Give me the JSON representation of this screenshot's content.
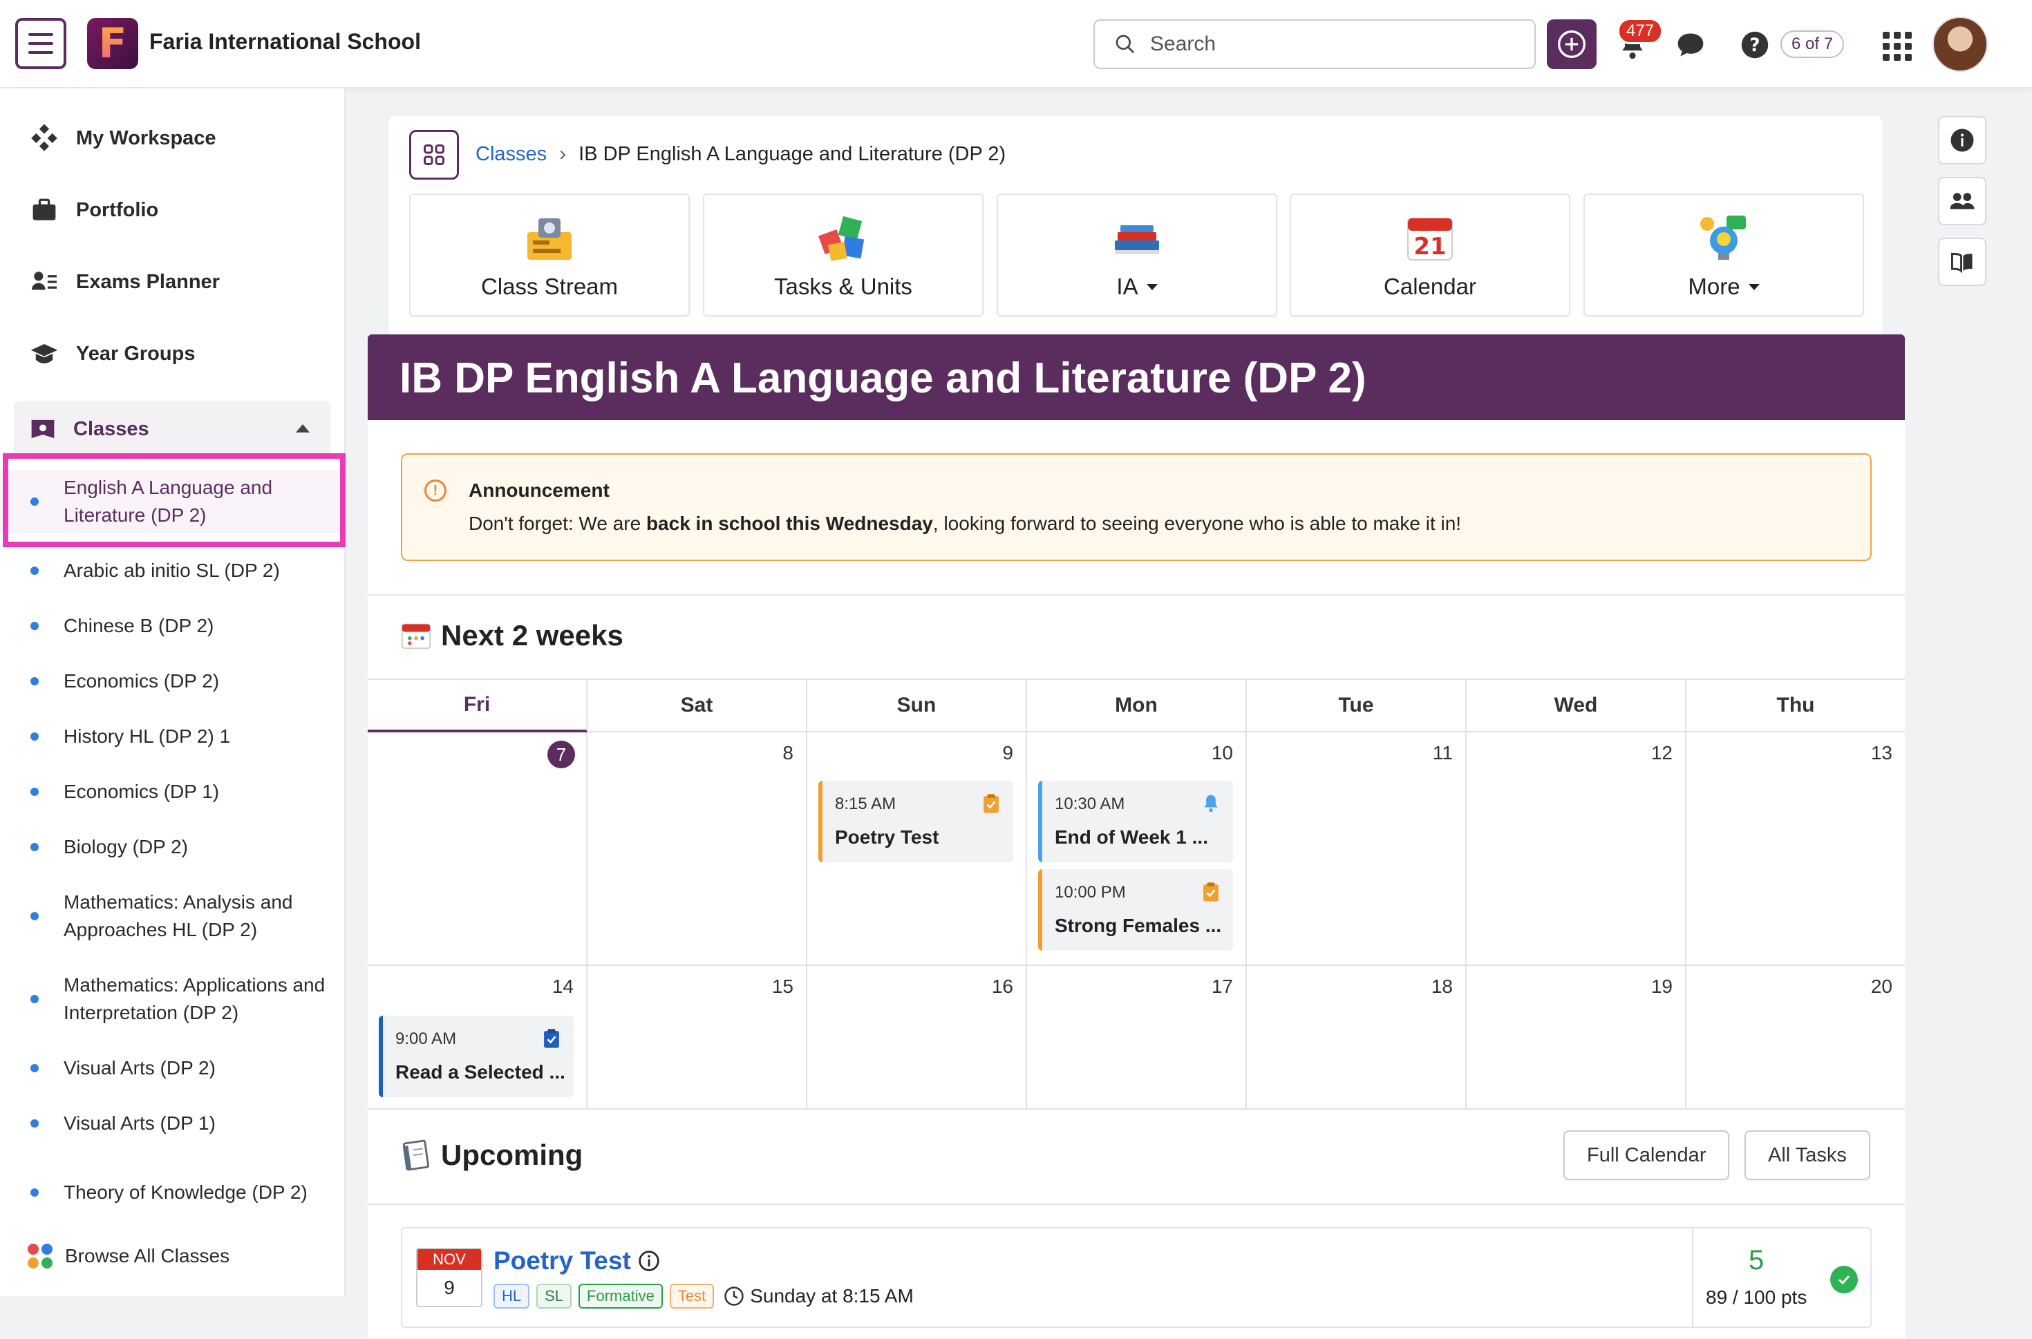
{
  "topbar": {
    "school_name": "Faria International School",
    "logo_letter": "F",
    "search_placeholder": "Search",
    "notification_count": "477",
    "pager": "6 of 7"
  },
  "sidebar": {
    "nav": [
      {
        "label": "My Workspace",
        "icon": "workspace-icon"
      },
      {
        "label": "Portfolio",
        "icon": "briefcase-icon"
      },
      {
        "label": "Exams Planner",
        "icon": "exams-planner-icon"
      },
      {
        "label": "Year Groups",
        "icon": "graduation-cap-icon"
      }
    ],
    "classes_label": "Classes",
    "classes": [
      {
        "label": "English A Language and Literature (DP 2)",
        "active": true
      },
      {
        "label": "Arabic ab initio SL (DP 2)"
      },
      {
        "label": "Chinese B (DP 2)"
      },
      {
        "label": "Economics (DP 2)"
      },
      {
        "label": "History HL (DP 2) 1"
      },
      {
        "label": "Economics (DP 1)"
      },
      {
        "label": "Biology (DP 2)"
      },
      {
        "label": "Mathematics: Analysis and Approaches HL (DP 2)"
      },
      {
        "label": "Mathematics: Applications and Interpretation (DP 2)"
      },
      {
        "label": "Visual Arts (DP 2)"
      },
      {
        "label": "Visual Arts (DP 1)"
      },
      {
        "label": "Theory of Knowledge (DP 2)"
      }
    ],
    "browse_all": "Browse All Classes"
  },
  "breadcrumb": {
    "root": "Classes",
    "current": "IB DP English A Language and Literature (DP 2)"
  },
  "tiles": [
    {
      "label": "Class Stream",
      "dropdown": false
    },
    {
      "label": "Tasks & Units",
      "dropdown": false
    },
    {
      "label": "IA",
      "dropdown": true
    },
    {
      "label": "Calendar",
      "dropdown": false,
      "calendar_day": "21"
    },
    {
      "label": "More",
      "dropdown": true
    }
  ],
  "class_title": "IB DP English A Language and Literature (DP 2)",
  "announcement": {
    "title": "Announcement",
    "text_before": "Don't forget: We are ",
    "text_bold": "back in school this Wednesday",
    "text_after": ", looking forward to seeing everyone who is able to make it in!"
  },
  "next_two_weeks": {
    "title": "Next 2 weeks",
    "days": [
      "Fri",
      "Sat",
      "Sun",
      "Mon",
      "Tue",
      "Wed",
      "Thu"
    ],
    "week1": [
      "7",
      "8",
      "9",
      "10",
      "11",
      "12",
      "13"
    ],
    "week2": [
      "14",
      "15",
      "16",
      "17",
      "18",
      "19",
      "20"
    ],
    "events": {
      "sun9": {
        "time": "8:15 AM",
        "name": "Poetry Test",
        "color": "#f0a030"
      },
      "mon10a": {
        "time": "10:30 AM",
        "name": "End of Week 1 ...",
        "color": "#4aa3e8"
      },
      "mon10b": {
        "time": "10:00 PM",
        "name": "Strong Females ...",
        "color": "#f0a030"
      },
      "fri14": {
        "time": "9:00 AM",
        "name": "Read a Selected ...",
        "color": "#1f5fbf"
      }
    }
  },
  "upcoming": {
    "title": "Upcoming",
    "full_calendar": "Full Calendar",
    "all_tasks": "All Tasks",
    "item": {
      "month": "NOV",
      "day": "9",
      "title": "Poetry Test",
      "tags": [
        "HL",
        "SL",
        "Formative",
        "Test"
      ],
      "when": "Sunday at 8:15 AM",
      "grade": "5",
      "points": "89 / 100 pts"
    }
  },
  "colors": {
    "brand": "#5b2d5f",
    "link": "#2463c7",
    "highlight": "#e83cb5"
  }
}
